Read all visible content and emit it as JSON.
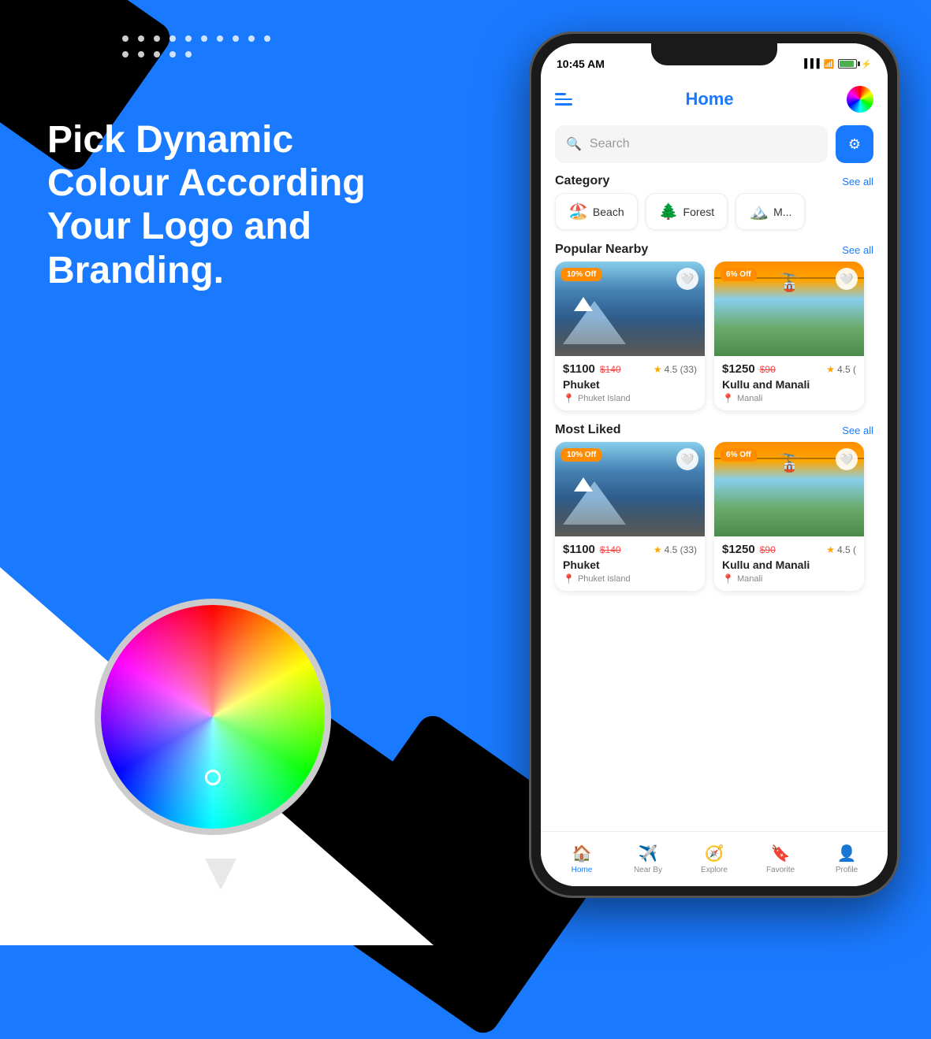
{
  "background": {
    "color": "#1a7aff"
  },
  "left": {
    "headline": "Pick Dynamic Colour According Your Logo and Branding."
  },
  "dots": [
    1,
    2,
    3,
    4,
    5,
    6,
    7,
    8,
    9,
    10,
    11,
    12,
    13,
    14,
    15
  ],
  "phone": {
    "statusBar": {
      "time": "10:45 AM",
      "battery": "100"
    },
    "header": {
      "title": "Home",
      "menuIcon": "menu-icon",
      "colorIcon": "color-wheel-icon"
    },
    "search": {
      "placeholder": "Search",
      "filterIcon": "filter-icon"
    },
    "category": {
      "title": "Category",
      "seeAll": "See all",
      "items": [
        {
          "emoji": "🏖️",
          "label": "Beach"
        },
        {
          "emoji": "🌲",
          "label": "Forest"
        },
        {
          "emoji": "🏔️",
          "label": "M..."
        }
      ]
    },
    "popularNearby": {
      "title": "Popular Nearby",
      "seeAll": "See all",
      "cards": [
        {
          "badge": "10% Off",
          "discount": "10% Off",
          "priceMain": "$1100",
          "priceOld": "$140",
          "rating": "4.5",
          "reviews": "33",
          "name": "Phuket",
          "location": "Phuket Island",
          "type": "phuket"
        },
        {
          "badge": "6% Off",
          "discount": "6% Off",
          "priceMain": "$1250",
          "priceOld": "$90",
          "rating": "4.5",
          "reviews": "",
          "name": "Kullu and Manali",
          "location": "Manali",
          "type": "kullu"
        }
      ]
    },
    "mostLiked": {
      "title": "Most Liked",
      "seeAll": "See all",
      "cards": [
        {
          "badge": "10% Off",
          "priceMain": "$1100",
          "priceOld": "$140",
          "rating": "4.5",
          "reviews": "33",
          "name": "Phuket",
          "location": "Phuket Island",
          "type": "phuket"
        },
        {
          "badge": "6% Off",
          "priceMain": "$1250",
          "priceOld": "$90",
          "rating": "4.5",
          "reviews": "",
          "name": "Kullu and Manali",
          "location": "Manali",
          "type": "kullu"
        }
      ]
    },
    "bottomNav": [
      {
        "icon": "🏠",
        "label": "Home",
        "active": true
      },
      {
        "icon": "✈️",
        "label": "Near By",
        "active": false
      },
      {
        "icon": "🧭",
        "label": "Explore",
        "active": false
      },
      {
        "icon": "🔖",
        "label": "Favorite",
        "active": false
      },
      {
        "icon": "👤",
        "label": "Profile",
        "active": false
      }
    ]
  }
}
